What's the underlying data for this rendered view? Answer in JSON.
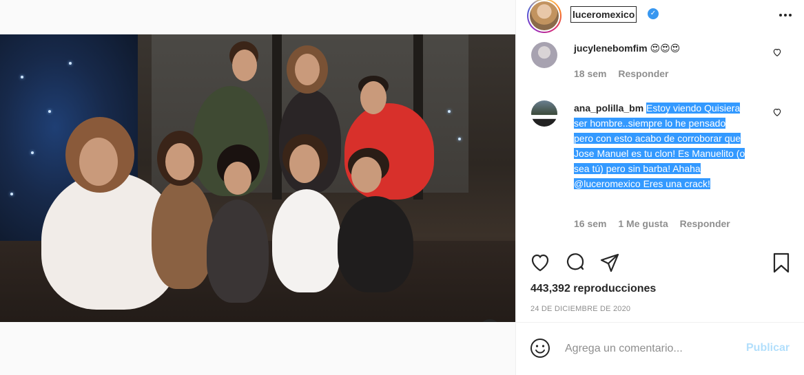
{
  "post": {
    "username": "luceromexico",
    "verified": true,
    "views": "443,392 reproducciones",
    "date": "24 DE DICIEMBRE DE 2020"
  },
  "comments": [
    {
      "user": "jucylenebomfim",
      "text": "😍😍😍",
      "time": "18 sem",
      "reply": "Responder"
    },
    {
      "user": "ana_polilla_bm",
      "text": "Estoy viendo Quisiera ser hombre..siempre lo he pensado pero con esto acabo de corroborar que Jose Manuel es tu clon! Es Manuelito (o sea tú) pero sin barba! Ahaha @luceromexico Eres una crack!",
      "time": "16 sem",
      "likes": "1 Me gusta",
      "reply": "Responder"
    }
  ],
  "add_comment": {
    "placeholder": "Agrega un comentario...",
    "publish": "Publicar"
  },
  "icons": {
    "verified": "verified-badge-icon",
    "more": "more-options-icon",
    "like": "heart-icon",
    "comment": "comment-bubble-icon",
    "share": "paper-plane-icon",
    "save": "bookmark-icon",
    "emoji": "smiley-icon",
    "mute": "volume-muted-icon"
  },
  "colors": {
    "selection": "#3399ff",
    "publish_disabled": "#b2dffc",
    "meta_gray": "#8e8e8e"
  }
}
